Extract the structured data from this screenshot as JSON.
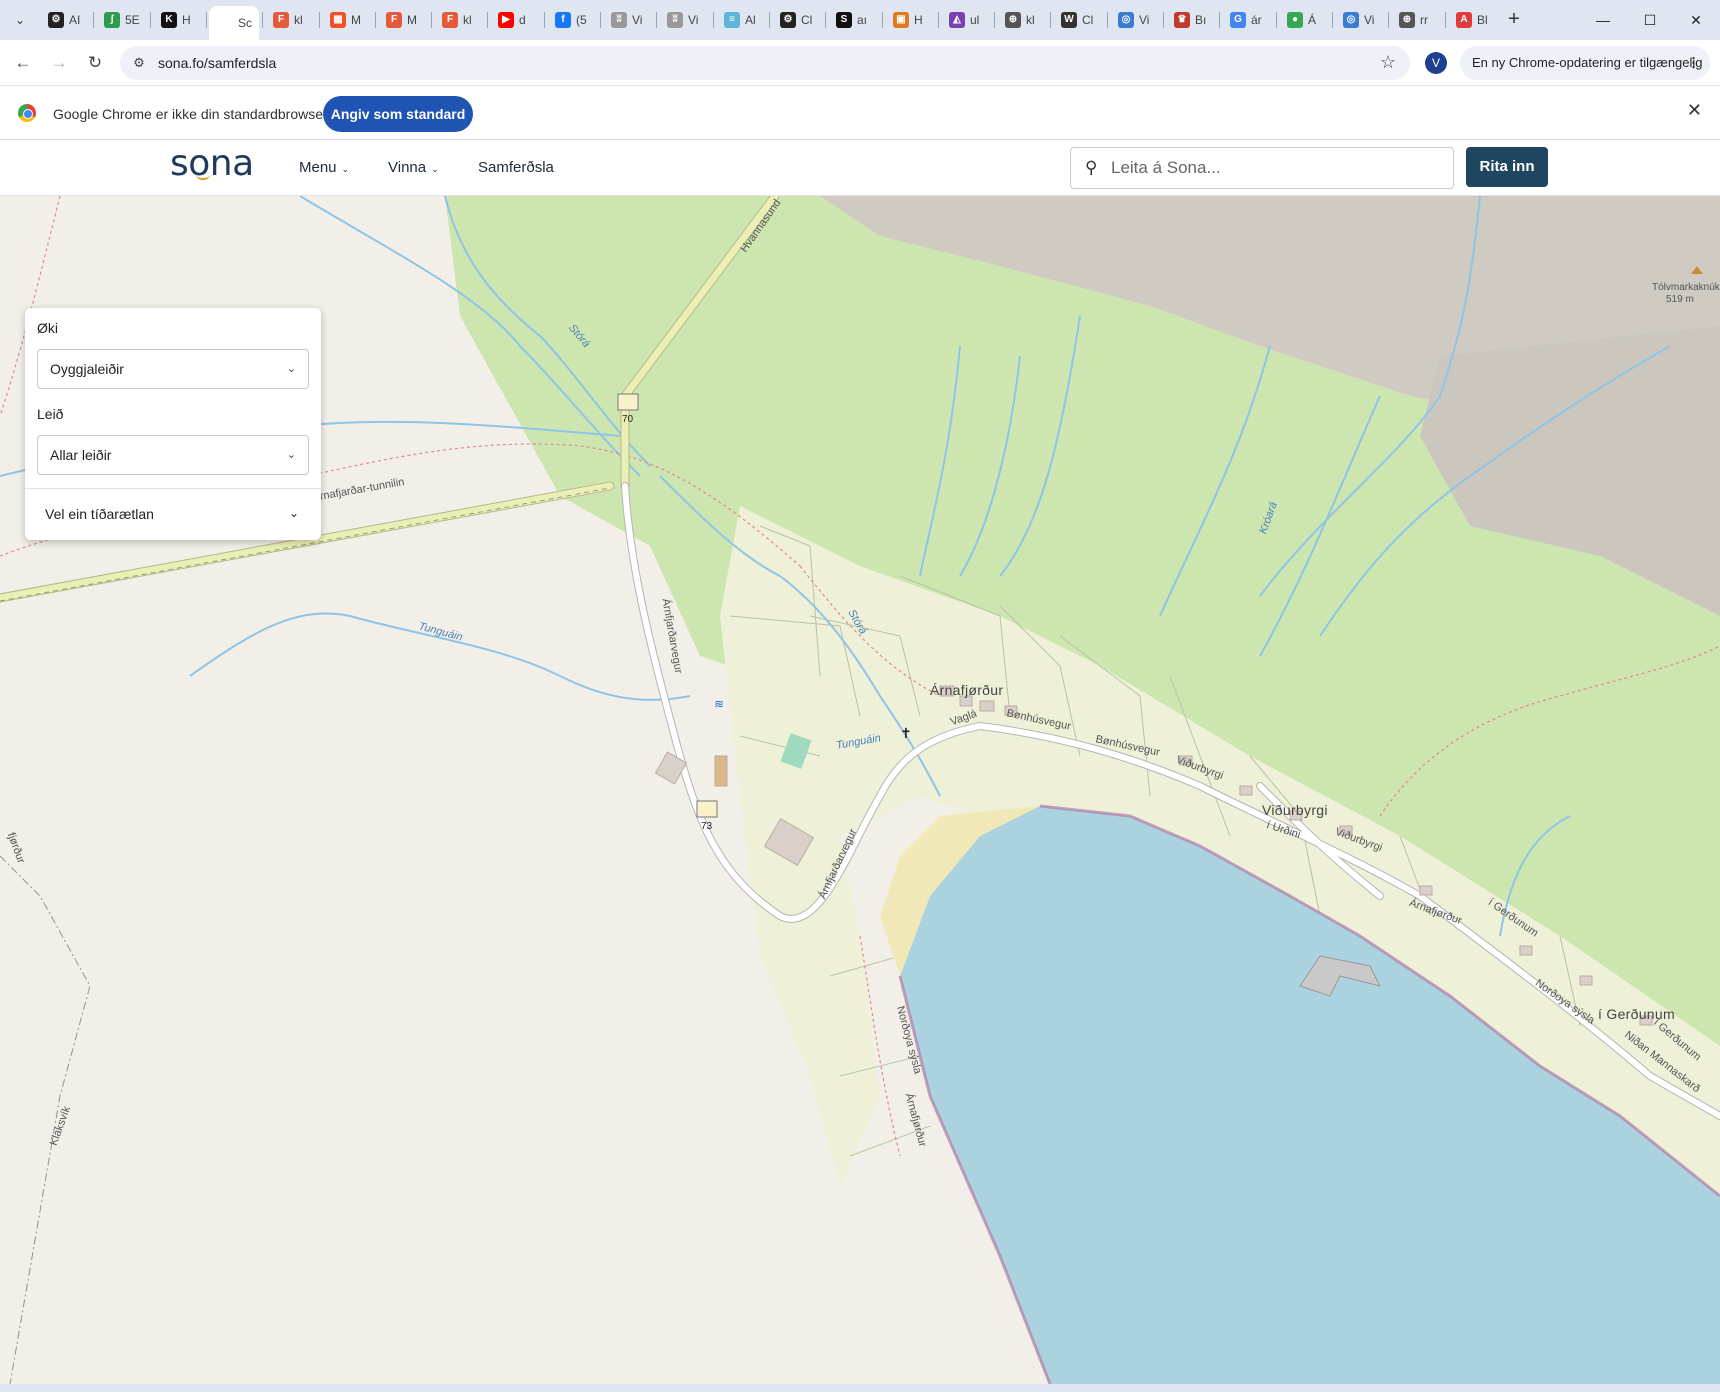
{
  "browser": {
    "tabs": [
      {
        "title": "AI",
        "icon": "openai-icon",
        "color": "#222222",
        "glyph": "⚙"
      },
      {
        "title": "5E",
        "icon": "leaf-icon",
        "color": "#2e9b4e",
        "glyph": "ʃ"
      },
      {
        "title": "H",
        "icon": "k-icon",
        "color": "#111111",
        "glyph": "K"
      },
      {
        "title": "Sc",
        "icon": "sona-icon",
        "color": "#ffffff",
        "glyph": "",
        "active": true
      },
      {
        "title": "kl",
        "icon": "figma-icon",
        "color": "#e55a3a",
        "glyph": "F"
      },
      {
        "title": "M",
        "icon": "microsoft-icon",
        "color": "#f25022",
        "glyph": "▦"
      },
      {
        "title": "M",
        "icon": "figma-icon",
        "color": "#e55a3a",
        "glyph": "F"
      },
      {
        "title": "kl",
        "icon": "figma-icon",
        "color": "#e55a3a",
        "glyph": "F"
      },
      {
        "title": "d",
        "icon": "youtube-icon",
        "color": "#ff0000",
        "glyph": "▶"
      },
      {
        "title": "(5",
        "icon": "facebook-icon",
        "color": "#1877f2",
        "glyph": "f"
      },
      {
        "title": "Vi",
        "icon": "vb-icon",
        "color": "#999999",
        "glyph": "ʬ"
      },
      {
        "title": "Vi",
        "icon": "vb-icon",
        "color": "#999999",
        "glyph": "ʬ"
      },
      {
        "title": "Al",
        "icon": "stripe-icon",
        "color": "#5fb6d9",
        "glyph": "≡"
      },
      {
        "title": "Cl",
        "icon": "openai-icon",
        "color": "#222222",
        "glyph": "⚙"
      },
      {
        "title": "aı",
        "icon": "s-icon",
        "color": "#111111",
        "glyph": "S"
      },
      {
        "title": "H",
        "icon": "image-icon",
        "color": "#e07a1f",
        "glyph": "▣"
      },
      {
        "title": "ul",
        "icon": "chart-icon",
        "color": "#7a3fb0",
        "glyph": "◭"
      },
      {
        "title": "kl",
        "icon": "globe-icon",
        "color": "#555555",
        "glyph": "⊕"
      },
      {
        "title": "Cl",
        "icon": "wikipedia-icon",
        "color": "#333333",
        "glyph": "W"
      },
      {
        "title": "Vi",
        "icon": "swirl-icon",
        "color": "#3a7bd5",
        "glyph": "◎"
      },
      {
        "title": "Bı",
        "icon": "crown-icon",
        "color": "#c0392b",
        "glyph": "♛"
      },
      {
        "title": "ár",
        "icon": "google-icon",
        "color": "#4285f4",
        "glyph": "G"
      },
      {
        "title": "Á",
        "icon": "green-circle-icon",
        "color": "#34a853",
        "glyph": "●"
      },
      {
        "title": "Vi",
        "icon": "swirl-icon",
        "color": "#3a7bd5",
        "glyph": "◎"
      },
      {
        "title": "rr",
        "icon": "globe-icon",
        "color": "#555555",
        "glyph": "⊕"
      },
      {
        "title": "Bl",
        "icon": "acrobat-icon",
        "color": "#e23b3b",
        "glyph": "A"
      }
    ],
    "tab_search_icon": "chevron-down-icon",
    "new_tab_icon": "plus-icon",
    "url": "sona.fo/samferdsla",
    "profile_initial": "V",
    "update_text": "En ny Chrome-opdatering er tilgængelig"
  },
  "infobar": {
    "message": "Google Chrome er ikke din standardbrowser",
    "button_label": "Angiv som standard",
    "accent": "#1f54b3"
  },
  "site": {
    "logo_text": "sona",
    "nav": [
      {
        "label": "Menu",
        "has_dropdown": true
      },
      {
        "label": "Vinna",
        "has_dropdown": true
      },
      {
        "label": "Samferðsla",
        "has_dropdown": false
      }
    ],
    "search_placeholder": "Leita á Sona...",
    "login_label": "Rita inn",
    "brand_color": "#1e4660"
  },
  "panel": {
    "area_label": "Øki",
    "area_value": "Oyggjaleiðir",
    "route_label": "Leið",
    "route_value": "Allar leiðir",
    "timetable_label": "Vel ein tíðarætlan"
  },
  "map": {
    "labels": {
      "town": "Árnafjørður",
      "village": "Viðurbyrgi",
      "gerdunum": "í Gerðunum",
      "stora1": "Stórá",
      "stora2": "Stórá",
      "tunguain": "Tunguáin",
      "tunguain2": "Tunguáin",
      "kroara": "Króará",
      "tunnel": "Árnafjarðar-tunnilin",
      "hvannasund": "Hvannasund",
      "arnafjardarvegur1": "Árnfjarðarvegur",
      "arnafjardarvegur2": "Árnfjarðarvegur",
      "vagla": "Vaglá",
      "bonhusvegur1": "Bønhúsvegur",
      "bonhusvegur2": "Bønhúsvegur",
      "vidurbyrgi_road1": "Viðurbyrgi",
      "vidurbyrgi_road2": "Viðurbyrgi",
      "urdini": "í Urðini",
      "gerdunum_road": "í Gerðunum",
      "gerdunum_road2": "í Gerðunum",
      "mannaskard": "Niðan Mannaskarð",
      "nordoya1": "Norðoya sýsla",
      "nordoya2": "Norðoya sýsla",
      "arnafjordur_coast": "Árnafjørður",
      "arnafjordur_coast2": "Árnafjørður",
      "klaksvik": "Klaksvík",
      "fjordur_left": "fjørður",
      "tolvmark": "Tólvmarkaknúkur",
      "tolvmark_elev": "519 m",
      "shield_70": "70",
      "shield_73": "73"
    },
    "colors": {
      "land": "#f2efe9",
      "grass": "#cde6b0",
      "meadow": "#eef0d8",
      "scree": "#c9c5bd",
      "water": "#aad3df",
      "stream": "#8ec4e6",
      "road": "#ffffff",
      "trunk": "#eaf0b5",
      "boundary": "#b27aa8"
    }
  }
}
